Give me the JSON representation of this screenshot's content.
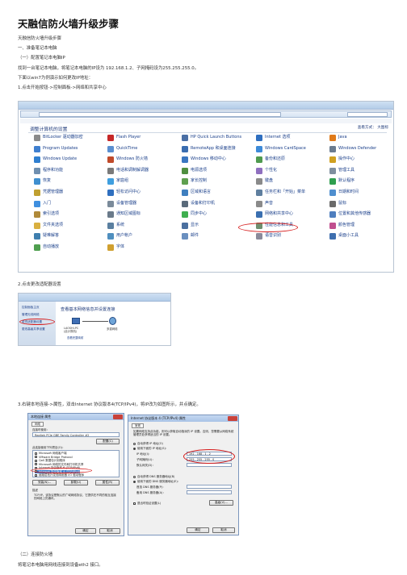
{
  "title": "天融信防火墙升级步骤",
  "lines": {
    "l1": "天融信防火墙升级步骤",
    "l2": "一、准备笔记本电脑",
    "l3": "（一）配置笔记本电脑IP",
    "l4": "找到一台笔记本电脑，将笔记本电脑的IP设为 192.168.1.2、子网掩码设为255.255.255.0。",
    "l5": "下面以win7为例演示如何更改IP地址：",
    "l6": "1.点击开始按钮->控制面板->网络和共享中心",
    "l7": "2.点击更改适配器设置",
    "l8": "3.右键本地连接->属性，双击Internet 协议版本4(TCP/IPv4)，将IP改为如图所示，并点确定。",
    "l9": "（二）连接防火墙",
    "l10": "将笔记本电脑用网线连接到设备eth2 接口。"
  },
  "control_panel": {
    "heading": "调整计算机的设置",
    "view_by": "查看方式：  大图标",
    "items": [
      {
        "label": "BitLocker 驱动器加密",
        "color": "#8a8a8a"
      },
      {
        "label": "Flash Player",
        "color": "#c62828"
      },
      {
        "label": "HP Quick Launch Buttons",
        "color": "#4a6fa5"
      },
      {
        "label": "Internet 选项",
        "color": "#2f6fc0"
      },
      {
        "label": "Java",
        "color": "#e07b1a"
      },
      {
        "label": "Program Updates",
        "color": "#3f7fcf"
      },
      {
        "label": "QuickTime",
        "color": "#5b8fd0"
      },
      {
        "label": "RemoteApp 和桌面连接",
        "color": "#3a6db0"
      },
      {
        "label": "Windows CardSpace",
        "color": "#3d8ad8"
      },
      {
        "label": "Windows Defender",
        "color": "#6a7b8f"
      },
      {
        "label": "Windows Update",
        "color": "#2f7fd0"
      },
      {
        "label": "Windows 防火墙",
        "color": "#c04a2a"
      },
      {
        "label": "Windows 移动中心",
        "color": "#3a76c0"
      },
      {
        "label": "备份和还原",
        "color": "#4f9a4f"
      },
      {
        "label": "操作中心",
        "color": "#d0a020"
      },
      {
        "label": "程序和功能",
        "color": "#6f8fb0"
      },
      {
        "label": "电话和调制解调器",
        "color": "#7a7a7a"
      },
      {
        "label": "电源选项",
        "color": "#4f8f3f"
      },
      {
        "label": "个性化",
        "color": "#8f6fbf"
      },
      {
        "label": "管理工具",
        "color": "#7f8f9f"
      },
      {
        "label": "恢复",
        "color": "#3f8fcf"
      },
      {
        "label": "家庭组",
        "color": "#3f9fdf"
      },
      {
        "label": "家长控制",
        "color": "#5fa04f"
      },
      {
        "label": "键盘",
        "color": "#8a8a8a"
      },
      {
        "label": "默认程序",
        "color": "#2f9f4f"
      },
      {
        "label": "凭据管理器",
        "color": "#c0a030"
      },
      {
        "label": "轻松访问中心",
        "color": "#2f6fbf"
      },
      {
        "label": "区域和语言",
        "color": "#3f7fbf"
      },
      {
        "label": "任务栏和「开始」菜单",
        "color": "#5f7f9f"
      },
      {
        "label": "日期和时间",
        "color": "#4f8fcf"
      },
      {
        "label": "入门",
        "color": "#3f8fdf"
      },
      {
        "label": "设备管理器",
        "color": "#7a8a9a"
      },
      {
        "label": "设备和打印机",
        "color": "#5a6a7a"
      },
      {
        "label": "声音",
        "color": "#8a8a8a"
      },
      {
        "label": "鼠标",
        "color": "#6a6a6a"
      },
      {
        "label": "索引选项",
        "color": "#b08a3a"
      },
      {
        "label": "通知区域图标",
        "color": "#6a7a8a"
      },
      {
        "label": "同步中心",
        "color": "#3faf4f"
      },
      {
        "label": "网络和共享中心",
        "color": "#3a6fb0"
      },
      {
        "label": "位置和其他传感器",
        "color": "#4f7fbf"
      },
      {
        "label": "文件夹选项",
        "color": "#d9b040"
      },
      {
        "label": "系统",
        "color": "#5a7fa0"
      },
      {
        "label": "显示",
        "color": "#4a6f9f"
      },
      {
        "label": "性能信息和工具",
        "color": "#6f8f6f"
      },
      {
        "label": "颜色管理",
        "color": "#c04f8f"
      },
      {
        "label": "疑难解答",
        "color": "#3f7faf"
      },
      {
        "label": "用户帐户",
        "color": "#4f8fbf"
      },
      {
        "label": "邮件",
        "color": "#6a8fbf"
      },
      {
        "label": "语音识别",
        "color": "#8a8a9a"
      },
      {
        "label": "桌面小工具",
        "color": "#3f6faf"
      },
      {
        "label": "自动播放",
        "color": "#4f9f4f"
      },
      {
        "label": "字体",
        "color": "#d0a030"
      }
    ]
  },
  "network_center": {
    "sidebar": [
      "控制面板主页",
      "管理无线网络",
      "更改适配器设置",
      "更改高级共享设置"
    ],
    "heading": "查看基本网络信息并设置连接",
    "pc_label": "LAOSHI-PC\n(此计算机)",
    "net_label": "多重网络",
    "link": "查看完整映射"
  },
  "props_dialog": {
    "title": "本地连接 属性",
    "tab": "网络",
    "connect_using": "连接时使用：",
    "adapter": "Realtek PCIe GBE Family Controller #2",
    "config_btn": "配置(C)",
    "uses": "此连接使用下列项目(O)：",
    "items": [
      "Microsoft 网络客户端",
      "VMware Bridge Protocol",
      "QoS 数据包计划程序",
      "Microsoft 网络的文件和打印机共享",
      "Internet 协议版本 6 (TCP/IPv6)",
      "Internet 协议版本 4 (TCP/IPv4)",
      "链路层拓扑发现映射器 I/O 驱动程序"
    ],
    "install": "安装(N)...",
    "uninstall": "卸载(U)",
    "properties": "属性(R)",
    "desc_title": "描述",
    "desc": "TCP/IP。该协议是默认的广域网络协议，它提供在不同的相互连接的网络上的通讯。",
    "ok": "确定",
    "cancel": "取消"
  },
  "ipv4_dialog": {
    "title": "Internet 协议版本 4 (TCP/IPv4) 属性",
    "tab": "常规",
    "intro": "如果网络支持此功能，则可以获取自动指派的 IP 设置。否则，您需要从网络系统管理员处获得适当的 IP 设置。",
    "auto_ip": "自动获得 IP 地址(O)",
    "use_ip": "使用下面的 IP 地址(S)：",
    "ip_label": "IP 地址(I)：",
    "ip_value": "192 . 168 .   1  .   2",
    "mask_label": "子网掩码(U)：",
    "mask_value": "255 . 255 . 255 .   0",
    "gw_label": "默认网关(D)：",
    "auto_dns": "自动获得 DNS 服务器地址(B)",
    "use_dns": "使用下面的 DNS 服务器地址(E)：",
    "dns1": "首选 DNS 服务器(P)：",
    "dns2": "备用 DNS 服务器(A)：",
    "validate": "退出时验证设置(L)",
    "advanced": "高级(V)...",
    "ok": "确定",
    "cancel": "取消"
  }
}
